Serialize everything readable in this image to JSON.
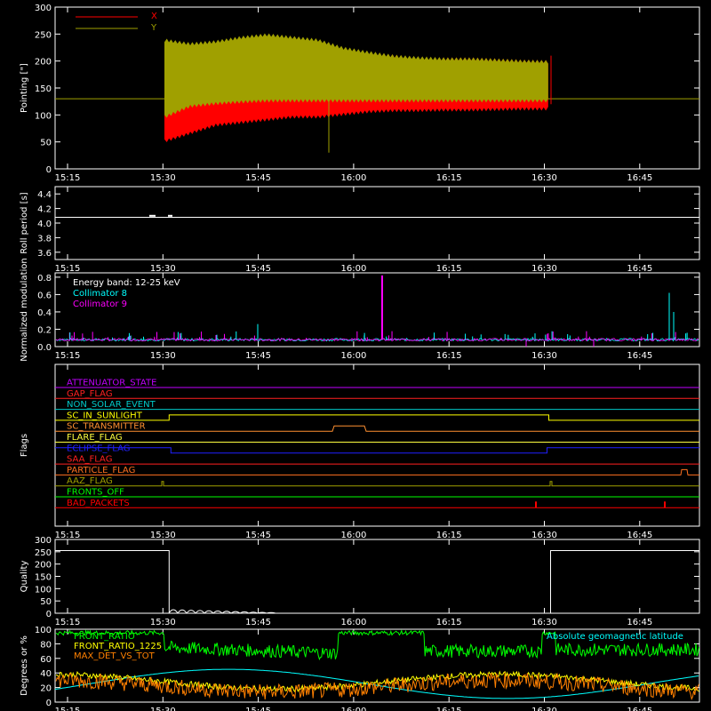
{
  "chart_data": [
    {
      "type": "line",
      "id": "pointing",
      "ylabel": "Pointing [\"]",
      "ylim": [
        0,
        300
      ],
      "yticks": [
        "0",
        "50",
        "100",
        "150",
        "200",
        "250",
        "300"
      ],
      "legend": [
        {
          "name": "X",
          "color": "#ff0000"
        },
        {
          "name": "Y",
          "color": "#a0a000"
        }
      ],
      "series": [
        {
          "name": "X",
          "color": "#ff0000",
          "x_start": "15:30",
          "x_end": "16:30",
          "upper": [
            230,
            225,
            230,
            235,
            235,
            230,
            225,
            215,
            210,
            205,
            200,
            200,
            200,
            198,
            196,
            195
          ],
          "lower": [
            55,
            70,
            85,
            90,
            95,
            100,
            100,
            105,
            110,
            112,
            112,
            113,
            113,
            114,
            115,
            115
          ]
        },
        {
          "name": "Y",
          "color": "#a0a000",
          "x_start": "15:30",
          "x_end": "16:30",
          "upper": [
            235,
            228,
            232,
            240,
            245,
            240,
            235,
            220,
            212,
            205,
            202,
            200,
            200,
            198,
            196,
            195
          ],
          "lower": [
            100,
            120,
            125,
            128,
            130,
            130,
            130,
            130,
            130,
            130,
            130,
            130,
            130,
            130,
            130,
            130
          ]
        }
      ],
      "baseline": 130
    },
    {
      "type": "line",
      "id": "roll",
      "ylabel": "Roll period [s]",
      "ylim": [
        3.5,
        4.5
      ],
      "yticks": [
        "3.6",
        "3.8",
        "4.0",
        "4.2",
        "4.4"
      ],
      "values": [
        4.08
      ]
    },
    {
      "type": "line",
      "id": "modulation",
      "ylabel": "Normalized modulation",
      "ylim": [
        0,
        0.85
      ],
      "yticks": [
        "0.0",
        "0.2",
        "0.4",
        "0.6",
        "0.8"
      ],
      "annotations": [
        {
          "text": "Energy band: 12-25 keV",
          "color": "#ffffff"
        },
        {
          "text": "Collimator 8",
          "color": "#00ffff"
        },
        {
          "text": "Collimator 9",
          "color": "#ff00ff"
        }
      ],
      "baseline": 0.08
    },
    {
      "type": "line",
      "id": "flags",
      "ylabel": "Flags",
      "flags": [
        {
          "name": "ATTENUATOR_STATE",
          "color": "#c000ff"
        },
        {
          "name": "GAP_FLAG",
          "color": "#ff2020"
        },
        {
          "name": "NON_SOLAR_EVENT",
          "color": "#00c8c8"
        },
        {
          "name": "SC_IN_SUNLIGHT",
          "color": "#ffff00"
        },
        {
          "name": "SC_TRANSMITTER",
          "color": "#ff9030"
        },
        {
          "name": "FLARE_FLAG",
          "color": "#ffff40"
        },
        {
          "name": "ECLIPSE_FLAG",
          "color": "#2020ff"
        },
        {
          "name": "SAA_FLAG",
          "color": "#ff2020"
        },
        {
          "name": "PARTICLE_FLAG",
          "color": "#ff7020"
        },
        {
          "name": "AAZ_FLAG",
          "color": "#a0a000"
        },
        {
          "name": "FRONTS_OFF",
          "color": "#00ff00"
        },
        {
          "name": "BAD_PACKETS",
          "color": "#ff0000"
        }
      ]
    },
    {
      "type": "line",
      "id": "quality",
      "ylabel": "Quality",
      "ylim": [
        0,
        300
      ],
      "yticks": [
        "0",
        "50",
        "100",
        "150",
        "200",
        "250",
        "300"
      ],
      "steps": [
        {
          "from": "15:15",
          "to": "15:30",
          "value": 255
        },
        {
          "from": "15:30",
          "to": "16:30",
          "value": 0
        },
        {
          "from": "16:30",
          "to": "16:51",
          "value": 255
        }
      ]
    },
    {
      "type": "line",
      "id": "ratios",
      "ylabel": "Degrees or %",
      "ylim": [
        0,
        100
      ],
      "yticks": [
        "0",
        "20",
        "40",
        "60",
        "80",
        "100"
      ],
      "legend": [
        {
          "name": "FRONT_RATIO",
          "color": "#00ff00"
        },
        {
          "name": "FRONT_RATIO_1225",
          "color": "#ffff00"
        },
        {
          "name": "MAX_DET_VS_TOT",
          "color": "#ff8000"
        }
      ],
      "annotation": {
        "text": "Absolute geomagnetic latitude",
        "color": "#00ffff"
      }
    }
  ],
  "x_axis": {
    "ticks": [
      "15:15",
      "15:30",
      "15:45",
      "16:00",
      "16:15",
      "16:30",
      "16:45"
    ]
  }
}
